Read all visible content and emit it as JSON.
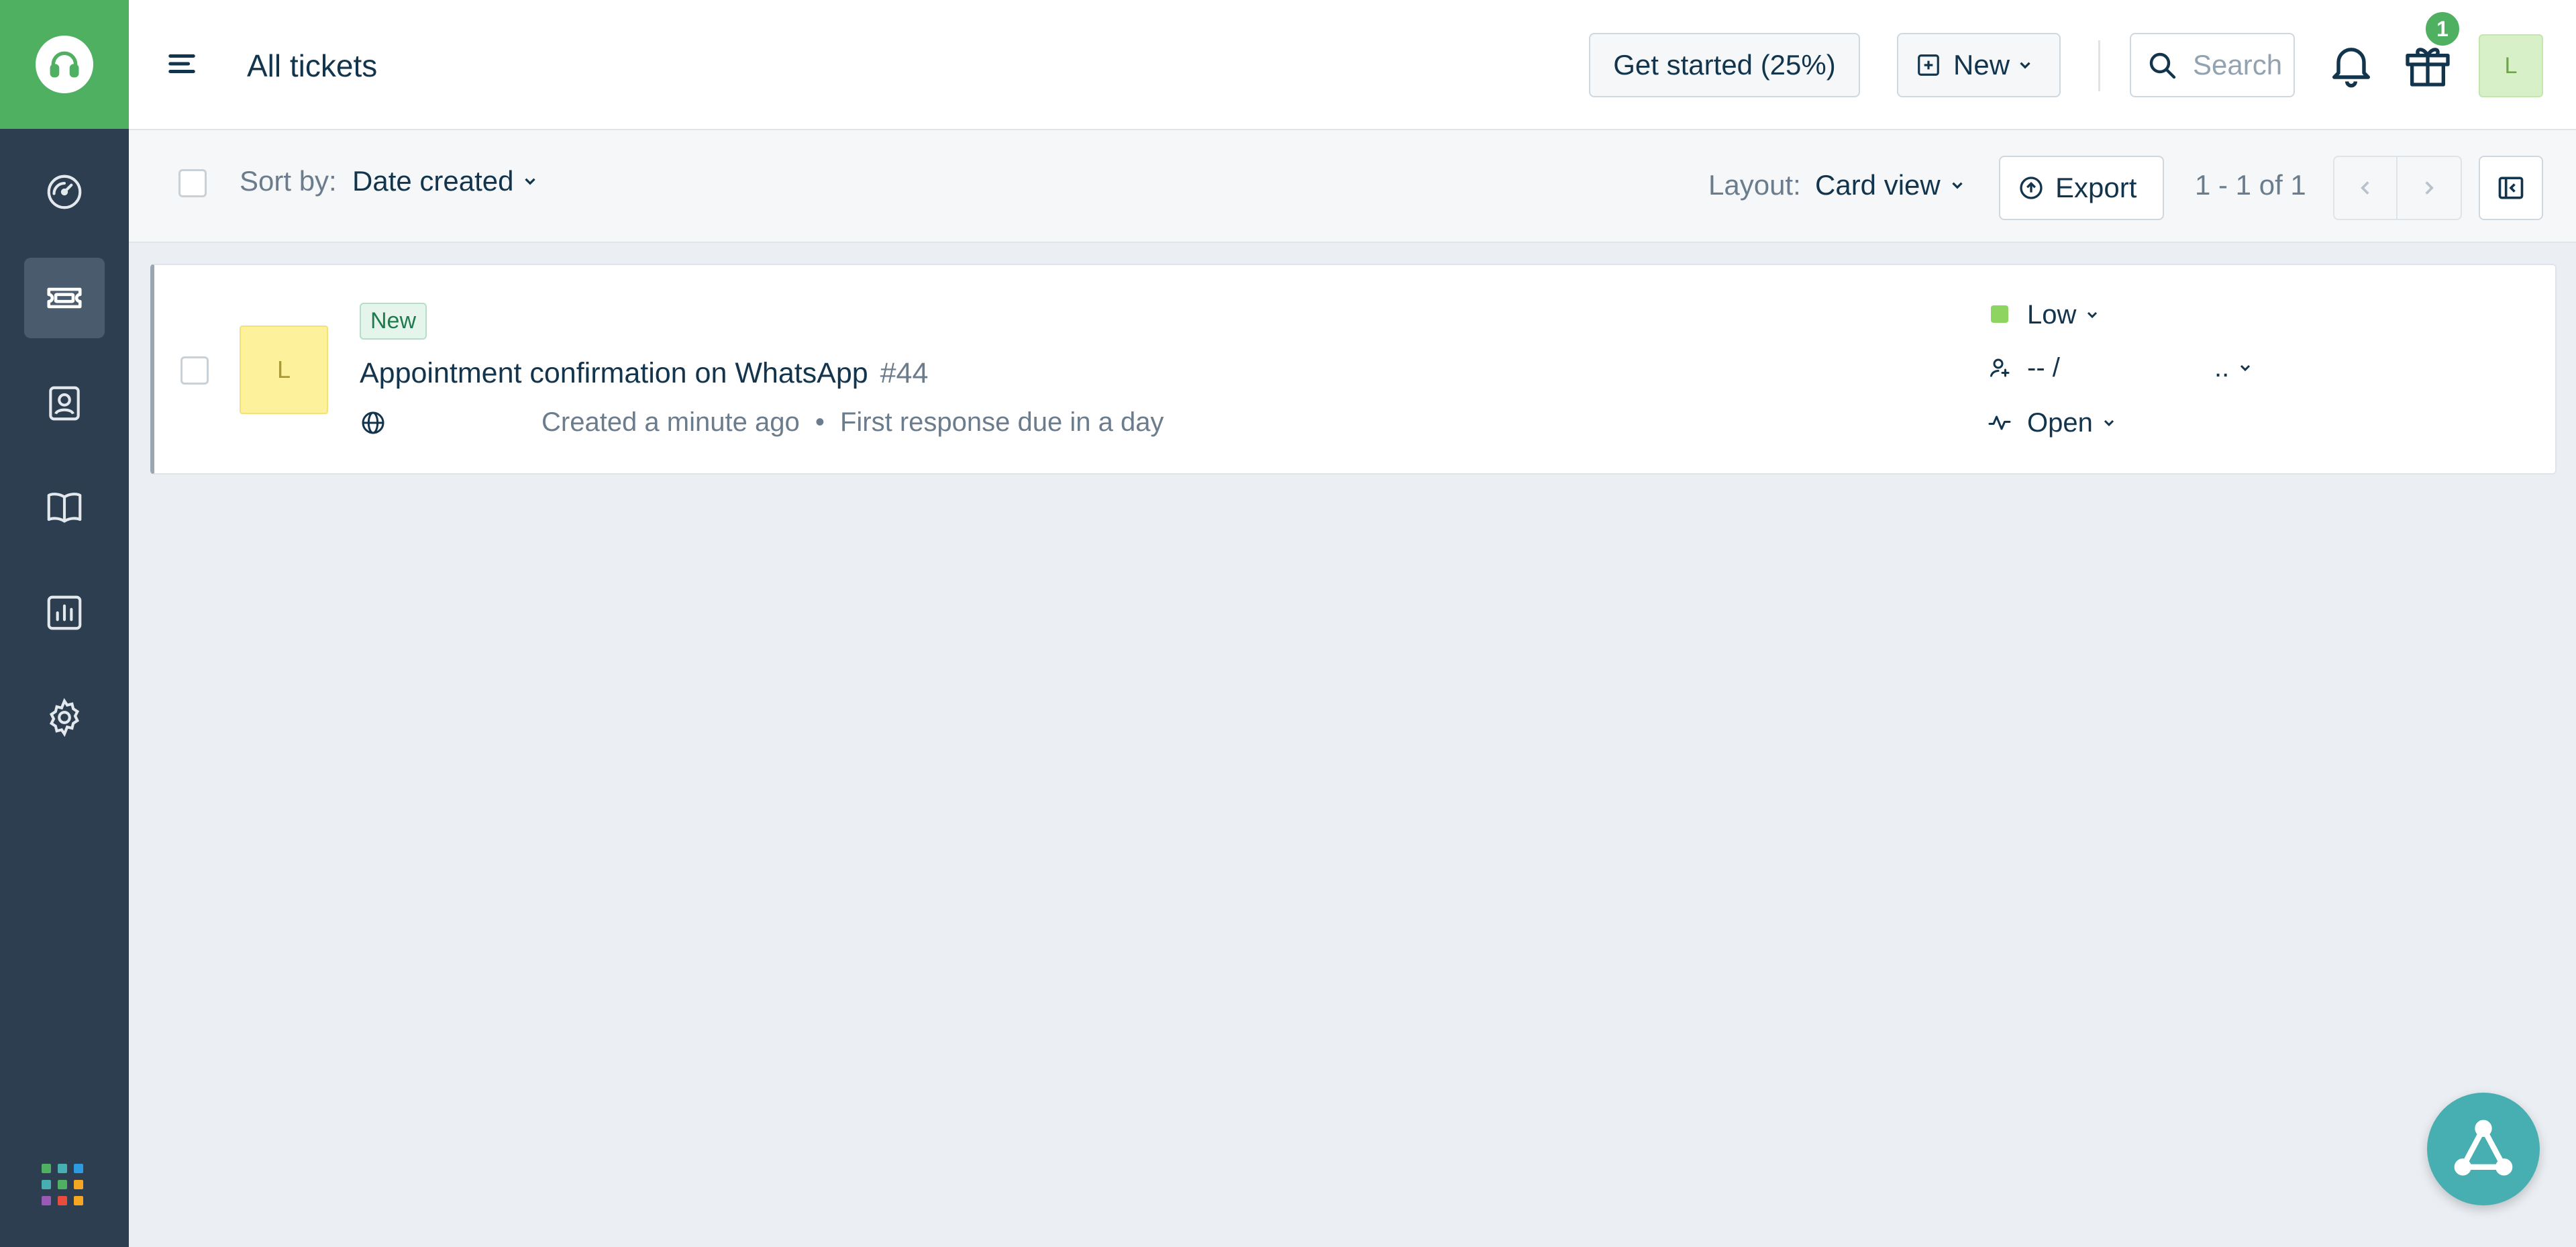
{
  "header": {
    "title": "All tickets",
    "get_started_label": "Get started (25%)",
    "new_label": "New",
    "search_placeholder": "Search",
    "gift_badge_count": "1",
    "avatar_initial": "L"
  },
  "toolbar": {
    "sort_by_label": "Sort by:",
    "sort_by_value": "Date created",
    "layout_label": "Layout:",
    "layout_value": "Card view",
    "export_label": "Export",
    "pagination": "1 - 1 of 1"
  },
  "tickets": [
    {
      "status_tag": "New",
      "avatar_initial": "L",
      "subject": "Appointment confirmation on WhatsApp",
      "id": "#44",
      "created": "Created a minute ago",
      "separator": "•",
      "due": "First response due in a day",
      "priority": "Low",
      "priority_color": "#8ed461",
      "assignee": "-- /",
      "assignee_group": "..",
      "status": "Open"
    }
  ],
  "colors": {
    "brand_green": "#4fb062",
    "sidebar_bg": "#2c3e50",
    "accent_teal": "#47aeb1",
    "avatar_yellow": "#fdf29b"
  },
  "sidebar": {
    "items": [
      {
        "icon": "dashboard-icon"
      },
      {
        "icon": "tickets-icon",
        "active": true
      },
      {
        "icon": "contacts-icon"
      },
      {
        "icon": "knowledge-base-icon"
      },
      {
        "icon": "reports-icon"
      },
      {
        "icon": "settings-icon"
      }
    ]
  }
}
